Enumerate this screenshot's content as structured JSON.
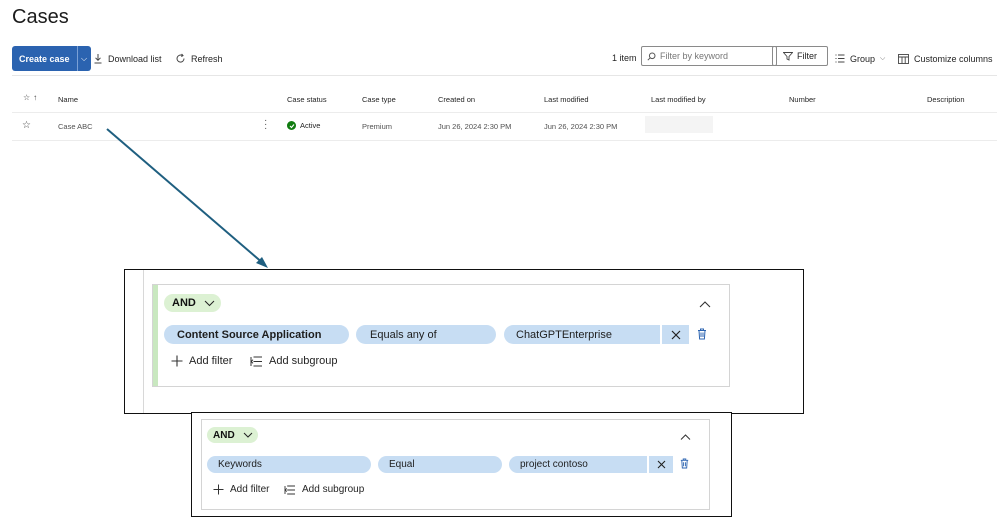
{
  "page": {
    "title": "Cases"
  },
  "toolbar": {
    "create_label": "Create case",
    "download_label": "Download list",
    "refresh_label": "Refresh",
    "item_count": "1 item",
    "search_placeholder": "Filter by keyword",
    "filter_label": "Filter",
    "group_label": "Group",
    "customize_label": "Customize columns"
  },
  "table": {
    "columns": {
      "name": "Name",
      "status": "Case status",
      "type": "Case type",
      "created": "Created on",
      "modified": "Last modified",
      "modified_by": "Last modified by",
      "number": "Number",
      "description": "Description"
    },
    "rows": [
      {
        "name": "Case ABC",
        "status": "Active",
        "type": "Premium",
        "created": "Jun 26, 2024 2:30 PM",
        "modified": "Jun 26, 2024 2:30 PM",
        "modified_by": "",
        "number": "",
        "description": ""
      }
    ]
  },
  "filter_panel_1": {
    "operator": "AND",
    "field": "Content Source Application",
    "condition": "Equals any of",
    "value": "ChatGPTEnterprise",
    "add_filter_label": "Add filter",
    "add_subgroup_label": "Add subgroup"
  },
  "filter_panel_2": {
    "operator": "AND",
    "field": "Keywords",
    "condition": "Equal",
    "value": "project contoso",
    "add_filter_label": "Add filter",
    "add_subgroup_label": "Add subgroup"
  },
  "colors": {
    "primary": "#2b63b0",
    "active_status": "#107c10",
    "chip": "#c7ddf3",
    "and_pill": "#dcf1d3",
    "arrow": "#1f5f80"
  }
}
